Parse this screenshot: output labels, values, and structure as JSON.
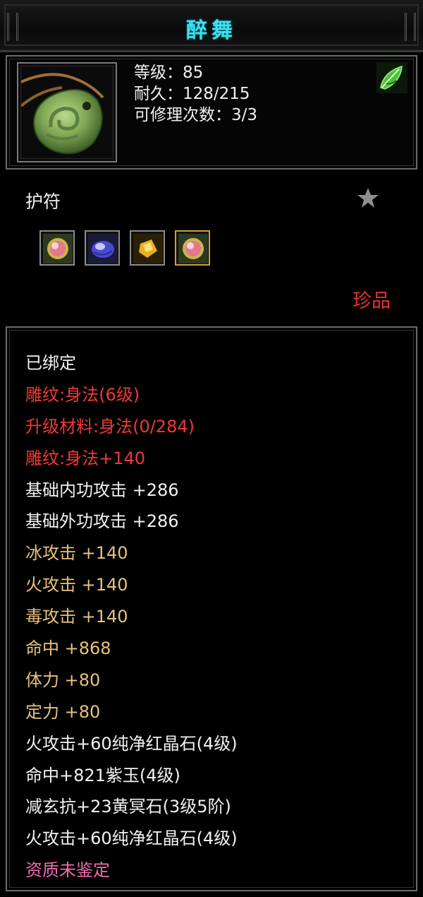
{
  "title": "醉舞",
  "header": {
    "stats": [
      "等级：85",
      "耐久：128/215",
      "可修理次数：3/3"
    ],
    "item_icon": "jade-pendant-icon",
    "type_icon": "green-leaf-icon"
  },
  "item_type": "护符",
  "favorite_icon": "star-icon",
  "gem_slots": [
    {
      "icon": "red-crystal-gem-icon"
    },
    {
      "icon": "purple-jade-gem-icon"
    },
    {
      "icon": "yellow-stone-gem-icon"
    },
    {
      "icon": "red-crystal-gem-icon"
    }
  ],
  "rarity": "珍品",
  "colors": {
    "title": "#3ee0f0",
    "white": "#f2f2f2",
    "red": "#ee3a33",
    "gold": "#e7c27d",
    "pink": "#f06cb0"
  },
  "attributes": [
    {
      "text": "已绑定",
      "color": "white"
    },
    {
      "text": "雕纹:身法(6级)",
      "color": "red"
    },
    {
      "text": "升级材料:身法(0/284)",
      "color": "red"
    },
    {
      "text": "雕纹:身法+140",
      "color": "red"
    },
    {
      "text": "基础内功攻击 +286",
      "color": "white"
    },
    {
      "text": "基础外功攻击 +286",
      "color": "white"
    },
    {
      "text": "冰攻击 +140",
      "color": "gold"
    },
    {
      "text": "火攻击 +140",
      "color": "gold"
    },
    {
      "text": "毒攻击 +140",
      "color": "gold"
    },
    {
      "text": "命中 +868",
      "color": "gold"
    },
    {
      "text": "体力 +80",
      "color": "gold"
    },
    {
      "text": "定力 +80",
      "color": "gold"
    },
    {
      "text": "火攻击+60纯净红晶石(4级)",
      "color": "white"
    },
    {
      "text": "命中+821紫玉(4级)",
      "color": "white"
    },
    {
      "text": "减玄抗+23黄冥石(3级5阶)",
      "color": "white"
    },
    {
      "text": "火攻击+60纯净红晶石(4级)",
      "color": "white"
    },
    {
      "text": "资质未鉴定",
      "color": "pink"
    }
  ]
}
